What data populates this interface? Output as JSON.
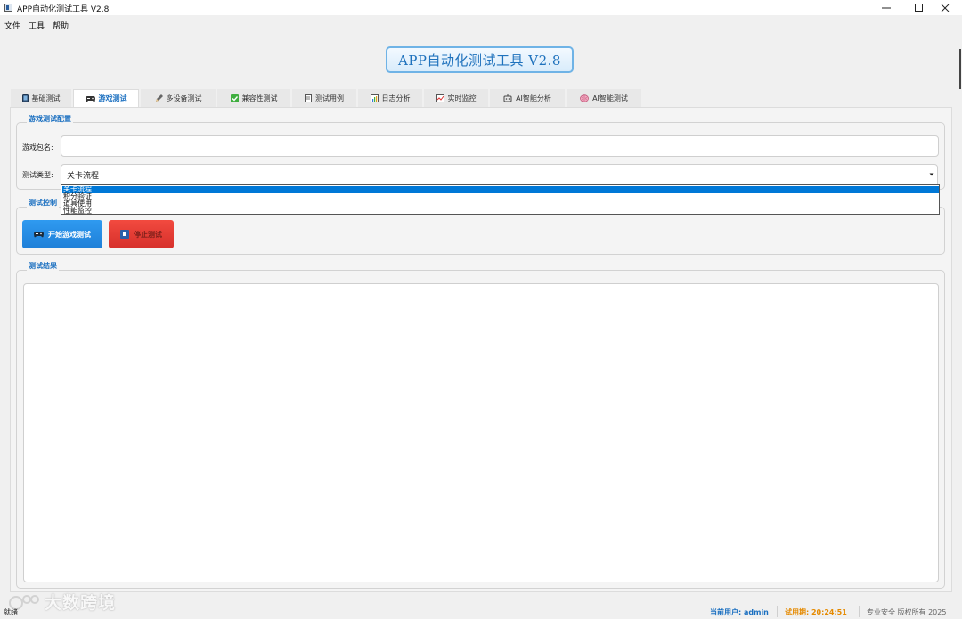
{
  "window": {
    "title": "APP自动化测试工具 V2.8",
    "controls": [
      "minimize",
      "maximize",
      "close"
    ]
  },
  "menu": [
    {
      "label": "文件"
    },
    {
      "label": "工具"
    },
    {
      "label": "帮助"
    }
  ],
  "banner": {
    "title": "APP自动化测试工具 V2.8"
  },
  "tabs": [
    {
      "label": "基础测试",
      "icon": "phone-icon"
    },
    {
      "label": "游戏测试",
      "icon": "gamepad-icon",
      "active": true
    },
    {
      "label": "多设备测试",
      "icon": "pencil-icon"
    },
    {
      "label": "兼容性测试",
      "icon": "checkbox-icon"
    },
    {
      "label": "测试用例",
      "icon": "document-icon"
    },
    {
      "label": "日志分析",
      "icon": "chart-icon"
    },
    {
      "label": "实时监控",
      "icon": "monitor-icon"
    },
    {
      "label": "AI智能分析",
      "icon": "robot-icon"
    },
    {
      "label": "AI智能测试",
      "icon": "brain-icon"
    }
  ],
  "config": {
    "group_title": "游戏测试配置",
    "package_label": "游戏包名:",
    "package_value": "",
    "type_label": "测试类型:",
    "type_selected": "关卡流程",
    "type_options": [
      "关卡流程",
      "积分验证",
      "道具使用",
      "性能监控"
    ],
    "type_highlighted_index": 0
  },
  "control": {
    "group_title": "测试控制",
    "start_label": "开始游戏测试",
    "stop_label": "停止测试"
  },
  "results": {
    "group_title": "测试结果",
    "content": ""
  },
  "status": {
    "left": "就绪",
    "user": "当前用户: admin",
    "trial": "试用期: 20:24:51",
    "copyright": "专业安全 版权所有 2025"
  },
  "watermark": {
    "text": "大数跨境"
  },
  "colors": {
    "accent": "#1a6fc0",
    "highlight": "#0078d7",
    "start_button": "#1e88e5",
    "stop_button": "#e53935",
    "trial_text": "#e58a00"
  }
}
